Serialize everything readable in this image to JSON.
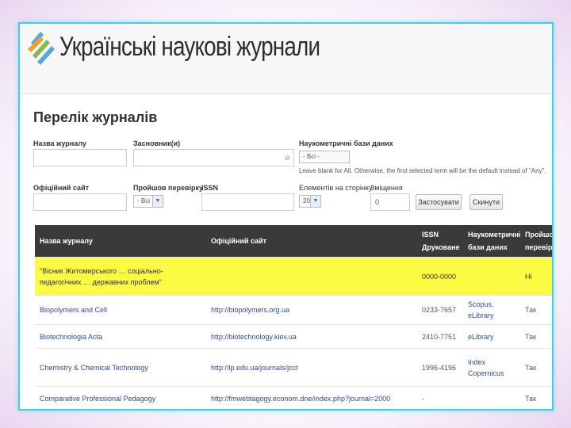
{
  "header": {
    "title": "Українські наукові журнали",
    "logo_colors": [
      "#5aa6d8",
      "#f0a030",
      "#7cc04a"
    ]
  },
  "page": {
    "title": "Перелік журналів"
  },
  "filters": {
    "journal_name_label": "Назва журналу",
    "journal_name_value": "",
    "founder_label": "Засновник(и)",
    "founder_value": "",
    "founder_clear": "⊘",
    "scientometric_label": "Наукометричні бази даних",
    "scientometric_value": "- Всі -",
    "scientometric_hint": "Leave blank for All. Otherwise, the first selected term will be the default instead of \"Any\".",
    "website_label": "Офіційний сайт",
    "website_value": "",
    "checked_label": "Пройшов перевірку",
    "checked_value": "- Всі -",
    "issn_label": "ISSN",
    "issn_value": "",
    "per_page_label": "Елементів на сторінку",
    "per_page_value": "20",
    "offset_label": "Зміщення",
    "offset_value": "0",
    "apply_button": "Застосувати",
    "reset_button": "Скинути"
  },
  "table": {
    "columns": [
      "Назва журналу",
      "Офіційний сайт",
      "ISSN Друковане",
      "Наукометричні бази даних",
      "Пройшов перевірку"
    ],
    "rows": [
      {
        "name": "\"Вісник Житомирського … соціально-педагогічних … державних проблем\"",
        "site": "",
        "issn": "0000-0000",
        "db": "",
        "checked": "Ні",
        "highlight": true
      },
      {
        "name": "Biopolymers and Cell",
        "site": "http://biopolymers.org.ua",
        "issn": "0233-7657",
        "db": "Scopus, eLibrary",
        "checked": "Так",
        "highlight": false
      },
      {
        "name": "Biotechnologia Acta",
        "site": "http://biotechnology.kiev.ua",
        "issn": "2410-7751",
        "db": "eLibrary",
        "checked": "Так",
        "highlight": false
      },
      {
        "name": "Chemistry & Chemical Technology",
        "site": "http://lp.edu.ua/journals/jcct",
        "issn": "1996-4196",
        "db": "Index Copernicus",
        "checked": "Так",
        "highlight": false
      },
      {
        "name": "Comparative Professional Pedagogy",
        "site": "http://fmwebtagogy.econom.dne/index.php?journal=2000",
        "issn": "-",
        "db": "",
        "checked": "Так",
        "highlight": false
      }
    ]
  }
}
